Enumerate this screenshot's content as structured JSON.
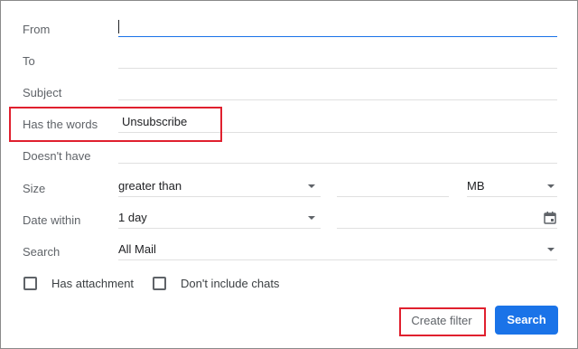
{
  "form": {
    "from": {
      "label": "From",
      "value": ""
    },
    "to": {
      "label": "To",
      "value": ""
    },
    "subject": {
      "label": "Subject",
      "value": ""
    },
    "has_words": {
      "label": "Has the words",
      "value": "Unsubscribe"
    },
    "doesnt_have": {
      "label": "Doesn't have",
      "value": ""
    },
    "size": {
      "label": "Size",
      "comparator": "greater than",
      "amount": "",
      "unit": "MB"
    },
    "date_within": {
      "label": "Date within",
      "range": "1 day",
      "date": ""
    },
    "search": {
      "label": "Search",
      "scope": "All Mail"
    }
  },
  "checkboxes": {
    "has_attachment": {
      "label": "Has attachment",
      "checked": false
    },
    "dont_include_chats": {
      "label": "Don't include chats",
      "checked": false
    }
  },
  "buttons": {
    "create_filter": "Create filter",
    "search": "Search"
  },
  "colors": {
    "accent": "#1a73e8",
    "highlight": "#e0202e",
    "label": "#5f6368"
  },
  "icons": {
    "dropdown": "triangle-down",
    "calendar": "calendar-icon"
  }
}
